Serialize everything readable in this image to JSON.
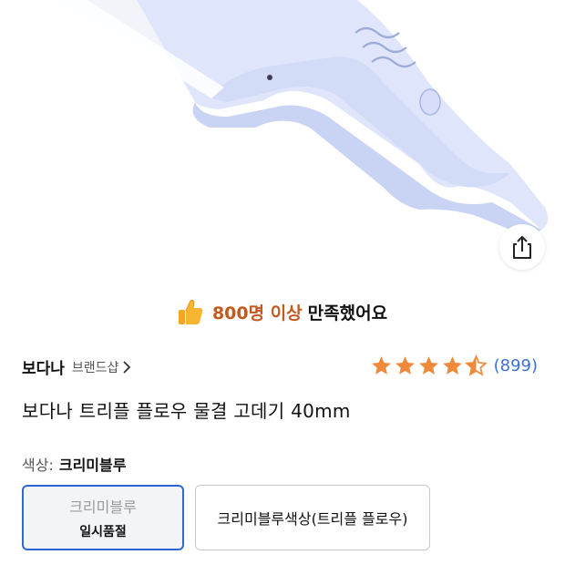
{
  "product_image": {
    "alt": "product-image"
  },
  "share": {
    "icon": "share-icon"
  },
  "promo": {
    "icon": "thumbs-up-icon",
    "count_text": "800명 이상",
    "rest_text": "만족했어요",
    "accent_color": "#c4591e"
  },
  "brand": {
    "name": "보다나",
    "shop_link": "브랜드샵",
    "chevron": "›"
  },
  "rating": {
    "stars": 4.5,
    "count": "(899)",
    "star_color": "#f0893a",
    "link_color": "#3b6fd6"
  },
  "product": {
    "title": "보다나 트리플 플로우 물결 고데기 40mm"
  },
  "color": {
    "label": "색상:",
    "selected": "크리미블루",
    "options": [
      {
        "name": "크리미블루",
        "status": "일시품절",
        "selected": true
      },
      {
        "name": "크리미블루색상(트리플 플로우)",
        "selected": false
      }
    ],
    "selected_border": "#2f68d6"
  }
}
